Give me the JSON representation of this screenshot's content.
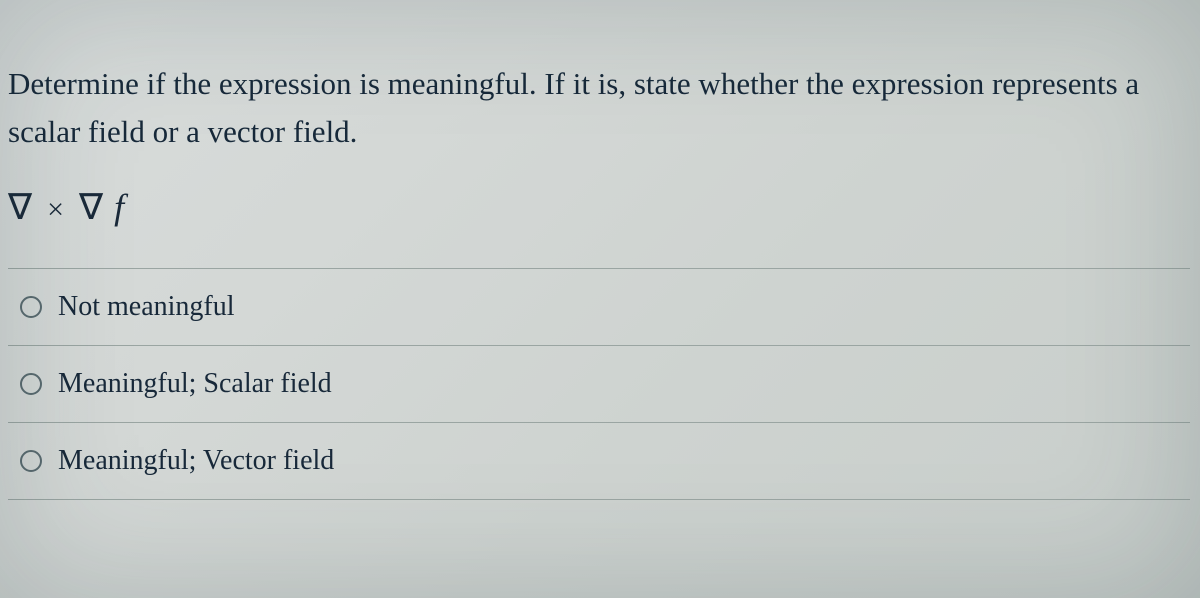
{
  "question": {
    "prompt": "Determine if the expression is meaningful. If it is, state whether the expression represents a scalar field or a vector field.",
    "expression_display": "∇ × ∇ f"
  },
  "options": [
    {
      "label": "Not meaningful"
    },
    {
      "label": "Meaningful; Scalar field"
    },
    {
      "label": "Meaningful; Vector field"
    }
  ]
}
